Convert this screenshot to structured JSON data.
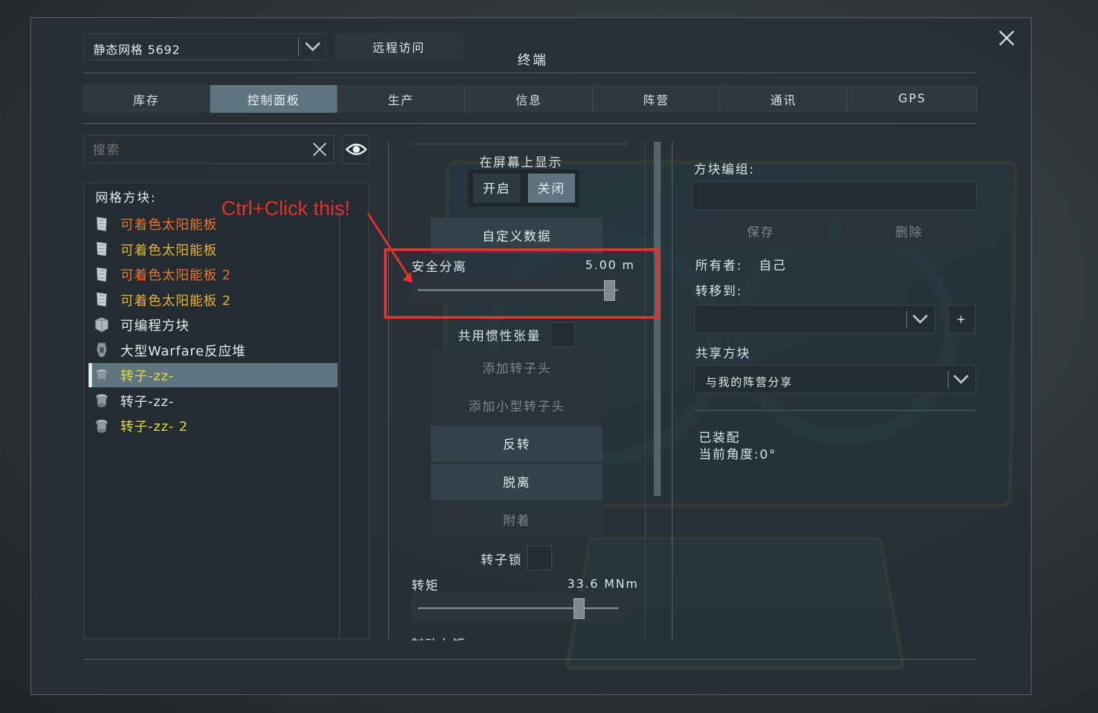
{
  "window": {
    "title": "终端",
    "grid_selector": "静态网格 5692",
    "remote_access_label": "远程访问"
  },
  "tabs": [
    {
      "label": "库存"
    },
    {
      "label": "控制面板"
    },
    {
      "label": "生产"
    },
    {
      "label": "信息"
    },
    {
      "label": "阵营"
    },
    {
      "label": "通讯"
    },
    {
      "label": "GPS"
    }
  ],
  "active_tab": "控制面板",
  "search": {
    "placeholder": "搜索"
  },
  "block_list": {
    "heading": "网格方块:",
    "items": [
      {
        "label": "可着色太阳能板",
        "color": "#e8742f",
        "icon": "solar-panel-icon"
      },
      {
        "label": "可着色太阳能板",
        "color": "#e7b236",
        "icon": "solar-panel-icon"
      },
      {
        "label": "可着色太阳能板 2",
        "color": "#e8742f",
        "icon": "solar-panel-icon"
      },
      {
        "label": "可着色太阳能板 2",
        "color": "#e7b236",
        "icon": "solar-panel-icon"
      },
      {
        "label": "可编程方块",
        "color": "#e4ecef",
        "icon": "programmable-block-icon"
      },
      {
        "label": "大型Warfare反应堆",
        "color": "#e4ecef",
        "icon": "reactor-icon"
      },
      {
        "label": "转子-zz-",
        "color": "#e7d93a",
        "icon": "rotor-icon",
        "selected": true
      },
      {
        "label": "转子-zz-",
        "color": "#e4ecef",
        "icon": "rotor-icon"
      },
      {
        "label": "转子-zz- 2",
        "color": "#e7d93a",
        "icon": "rotor-icon"
      }
    ]
  },
  "controls": {
    "show_on_screen": "在屏幕上显示",
    "on_label": "开启",
    "off_label": "关闭",
    "custom_data": "自定义数据",
    "safety_detach": "安全分离",
    "safety_detach_value": "5.00 m",
    "safety_detach_level": 0.95,
    "share_inertia": "共用惯性张量",
    "add_rotor_head": "添加转子头",
    "add_small_rotor_head": "添加小型转子头",
    "reverse": "反转",
    "detach": "脱离",
    "attach": "附着",
    "rotor_lock": "转子锁",
    "torque": "转矩",
    "torque_value": "33.6 MNm",
    "torque_level": 0.8,
    "cut_off_text": "制动力矩"
  },
  "block_panel": {
    "group_label": "方块编组:",
    "save": "保存",
    "delete": "删除",
    "owner_label": "所有者:",
    "owner_value": "自己",
    "transfer_label": "转移到:",
    "add": "+",
    "share_label": "共享方块",
    "share_value": "与我的阵营分享",
    "status_line1": "已装配",
    "status_line2": "当前角度:0°"
  },
  "annotation": {
    "text": "Ctrl+Click this!",
    "color": "#e8302c"
  }
}
